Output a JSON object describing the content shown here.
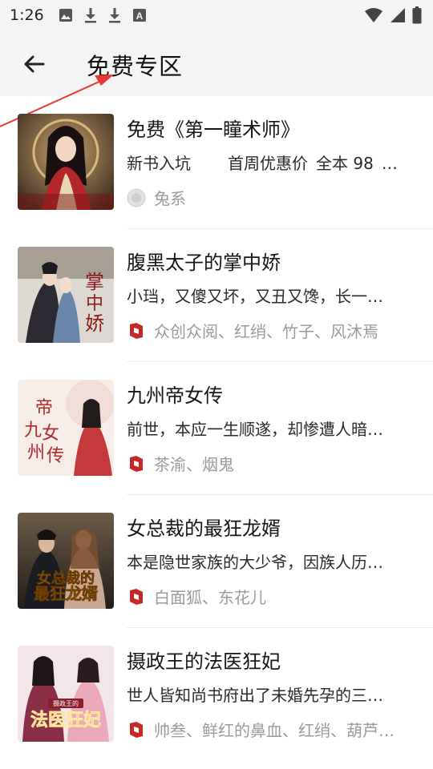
{
  "status_bar": {
    "time": "1:26",
    "icons": [
      "image-icon",
      "download-icon",
      "download-icon",
      "font-icon"
    ],
    "right_icons": [
      "wifi-icon",
      "signal-icon",
      "battery-icon"
    ]
  },
  "header": {
    "title": "免费专区",
    "back_icon": "arrow-left-icon"
  },
  "colors": {
    "background": "#ffffff",
    "header_bg": "#f4f4f4",
    "annotation_red": "#e53935",
    "meta_gray": "#9a9a9a",
    "author_icon_red": "#c62828"
  },
  "books": [
    {
      "title": "免费《第一瞳术师》",
      "desc_parts": [
        "新书入坑",
        "首周优惠价",
        "全本 98",
        "…"
      ],
      "author": "兔系",
      "author_icon": "avatar-placeholder-icon"
    },
    {
      "title": "腹黑太子的掌中娇",
      "desc": "小珰，又傻又坏，又丑又馋，长一…",
      "author": "众创众阅、红绡、竹子、风沐焉",
      "author_icon": "publisher-logo-icon"
    },
    {
      "title": "九州帝女传",
      "desc": "前世，本应一生顺遂，却惨遭人暗…",
      "author": "茶渝、烟鬼",
      "author_icon": "publisher-logo-icon"
    },
    {
      "title": "女总裁的最狂龙婿",
      "desc": "本是隐世家族的大少爷，因族人历…",
      "author": "白面狐、东花儿",
      "author_icon": "publisher-logo-icon"
    },
    {
      "title": "摄政王的法医狂妃",
      "desc": "世人皆知尚书府出了未婚先孕的三…",
      "author": "帅叁、鲜红的鼻血、红绡、葫芦…",
      "author_icon": "publisher-logo-icon"
    }
  ]
}
